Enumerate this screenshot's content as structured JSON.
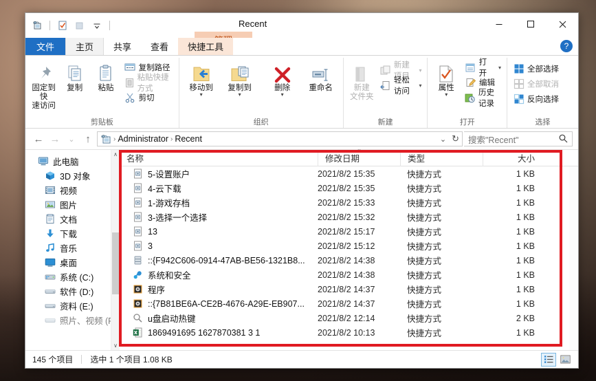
{
  "window": {
    "title": "Recent",
    "contextual_tab": "管理",
    "minimize": "–",
    "maximize": "□",
    "close": "✕"
  },
  "quick_access": {
    "items": [
      {
        "name": "properties-icon",
        "glyph": "🗐"
      },
      {
        "name": "checkbox-icon",
        "glyph": "✓"
      },
      {
        "name": "folder-icon",
        "glyph": "▭"
      },
      {
        "name": "customize-dropdown-icon",
        "glyph": "▾"
      }
    ]
  },
  "tabs": [
    {
      "id": "file",
      "label": "文件"
    },
    {
      "id": "home",
      "label": "主页"
    },
    {
      "id": "share",
      "label": "共享"
    },
    {
      "id": "view",
      "label": "查看"
    },
    {
      "id": "tools",
      "label": "快捷工具"
    }
  ],
  "help_label": "?",
  "ribbon": {
    "groups": [
      {
        "name": "剪贴板",
        "big": [
          {
            "label": "固定到快\n速访问",
            "label_l1": "固定到快",
            "label_l2": "速访问",
            "icon": "pin-icon"
          },
          {
            "label": "复制",
            "icon": "copy-icon"
          },
          {
            "label": "粘贴",
            "icon": "paste-icon"
          }
        ],
        "small": [
          {
            "label": "复制路径",
            "icon": "copy-path-icon",
            "disabled": false
          },
          {
            "label": "粘贴快捷方式",
            "icon": "paste-shortcut-icon",
            "disabled": true
          },
          {
            "label": "剪切",
            "icon": "cut-icon",
            "disabled": false
          }
        ]
      },
      {
        "name": "组织",
        "big": [
          {
            "label": "移动到",
            "icon": "move-to-icon",
            "has_caret": true
          },
          {
            "label": "复制到",
            "icon": "copy-to-icon",
            "has_caret": true
          },
          {
            "label": "删除",
            "icon": "delete-icon",
            "has_caret": true
          },
          {
            "label": "重命名",
            "icon": "rename-icon"
          }
        ]
      },
      {
        "name": "新建",
        "big": [
          {
            "label_l1": "新建",
            "label_l2": "文件夹",
            "icon": "new-folder-icon",
            "disabled": true
          }
        ],
        "small": [
          {
            "label": "新建项目",
            "icon": "new-item-icon",
            "disabled": true,
            "has_caret": true
          },
          {
            "label": "轻松访问",
            "icon": "easy-access-icon",
            "disabled": false,
            "has_caret": true
          }
        ]
      },
      {
        "name": "打开",
        "big": [
          {
            "label": "属性",
            "icon": "properties-icon",
            "has_caret": true
          }
        ],
        "small": [
          {
            "label": "打开",
            "icon": "open-icon",
            "has_caret": true
          },
          {
            "label": "编辑",
            "icon": "edit-icon"
          },
          {
            "label": "历史记录",
            "icon": "history-icon"
          }
        ]
      },
      {
        "name": "选择",
        "small": [
          {
            "label": "全部选择",
            "icon": "select-all-icon"
          },
          {
            "label": "全部取消",
            "icon": "select-none-icon",
            "disabled": true
          },
          {
            "label": "反向选择",
            "icon": "invert-selection-icon"
          }
        ]
      }
    ]
  },
  "address": {
    "back": "←",
    "forward": "→",
    "recent_dropdown": "⌄",
    "up": "↑",
    "crumbs": [
      "Administrator",
      "Recent"
    ],
    "crumb_separator": "›",
    "path_dropdown": "⌄",
    "refresh": "↻",
    "search_placeholder": "搜索\"Recent\"",
    "search_value": "",
    "search_icon": "⚲"
  },
  "nav_pane": {
    "items": [
      {
        "label": "此电脑",
        "icon": "this-pc-icon",
        "level": 1
      },
      {
        "label": "3D 对象",
        "icon": "3d-objects-icon",
        "level": 2
      },
      {
        "label": "视频",
        "icon": "videos-icon",
        "level": 2
      },
      {
        "label": "图片",
        "icon": "pictures-icon",
        "level": 2
      },
      {
        "label": "文档",
        "icon": "documents-icon",
        "level": 2
      },
      {
        "label": "下载",
        "icon": "downloads-icon",
        "level": 2
      },
      {
        "label": "音乐",
        "icon": "music-icon",
        "level": 2
      },
      {
        "label": "桌面",
        "icon": "desktop-icon",
        "level": 2
      },
      {
        "label": "系统 (C:)",
        "icon": "system-drive-icon",
        "level": 2
      },
      {
        "label": "软件 (D:)",
        "icon": "drive-icon",
        "level": 2
      },
      {
        "label": "资料 (E:)",
        "icon": "drive-icon",
        "level": 2
      },
      {
        "label": "照片、视频 (F:)",
        "icon": "drive-icon",
        "level": 2
      }
    ],
    "scroll_up": "∧",
    "scroll_down": "∨"
  },
  "file_list": {
    "columns": [
      {
        "key": "name",
        "label": "名称"
      },
      {
        "key": "date",
        "label": "修改日期",
        "sorted": true,
        "sort_dir": "desc"
      },
      {
        "key": "type",
        "label": "类型"
      },
      {
        "key": "size",
        "label": "大小"
      }
    ],
    "sort_glyph": "⌄",
    "rows": [
      {
        "name": "5-设置账户",
        "date": "2021/8/2 15:35",
        "type": "快捷方式",
        "size": "1 KB",
        "icon": "shortcut-file-icon"
      },
      {
        "name": "4-云下载",
        "date": "2021/8/2 15:35",
        "type": "快捷方式",
        "size": "1 KB",
        "icon": "shortcut-file-icon"
      },
      {
        "name": "1-游戏存档",
        "date": "2021/8/2 15:33",
        "type": "快捷方式",
        "size": "1 KB",
        "icon": "shortcut-file-icon"
      },
      {
        "name": "3-选择一个选择",
        "date": "2021/8/2 15:32",
        "type": "快捷方式",
        "size": "1 KB",
        "icon": "shortcut-file-icon"
      },
      {
        "name": "13",
        "date": "2021/8/2 15:17",
        "type": "快捷方式",
        "size": "1 KB",
        "icon": "shortcut-file-icon"
      },
      {
        "name": "3",
        "date": "2021/8/2 15:12",
        "type": "快捷方式",
        "size": "1 KB",
        "icon": "shortcut-file-icon"
      },
      {
        "name": "::{F942C606-0914-47AB-BE56-1321B8...",
        "date": "2021/8/2 14:38",
        "type": "快捷方式",
        "size": "1 KB",
        "icon": "storage-icon"
      },
      {
        "name": "系统和安全",
        "date": "2021/8/2 14:38",
        "type": "快捷方式",
        "size": "1 KB",
        "icon": "security-icon"
      },
      {
        "name": "程序",
        "date": "2021/8/2 14:37",
        "type": "快捷方式",
        "size": "1 KB",
        "icon": "programs-icon"
      },
      {
        "name": "::{7B81BE6A-CE2B-4676-A29E-EB907...",
        "date": "2021/8/2 14:37",
        "type": "快捷方式",
        "size": "1 KB",
        "icon": "programs-icon"
      },
      {
        "name": "u盘启动热键",
        "date": "2021/8/2 12:14",
        "type": "快捷方式",
        "size": "2 KB",
        "icon": "search-file-icon"
      },
      {
        "name": "1869491695 1627870381 3 1",
        "date": "2021/8/2 10:13",
        "type": "快捷方式",
        "size": "1 KB",
        "icon": "excel-icon"
      }
    ]
  },
  "status_bar": {
    "item_count": "145 个项目",
    "selection": "选中 1 个项目  1.08 KB",
    "views": [
      {
        "name": "details-view-button",
        "selected": true
      },
      {
        "name": "large-icons-view-button",
        "selected": false
      }
    ]
  },
  "annotation": {
    "color": "#e01b22",
    "shape": "rectangle"
  }
}
